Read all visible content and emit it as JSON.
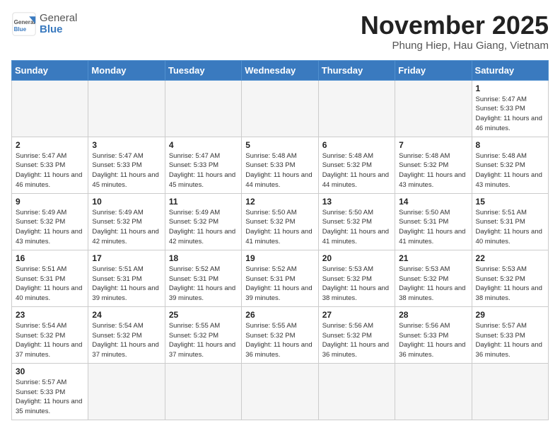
{
  "header": {
    "logo_text_1": "General",
    "logo_text_2": "Blue",
    "month_title": "November 2025",
    "location": "Phung Hiep, Hau Giang, Vietnam"
  },
  "weekdays": [
    "Sunday",
    "Monday",
    "Tuesday",
    "Wednesday",
    "Thursday",
    "Friday",
    "Saturday"
  ],
  "weeks": [
    [
      {
        "day": "",
        "info": ""
      },
      {
        "day": "",
        "info": ""
      },
      {
        "day": "",
        "info": ""
      },
      {
        "day": "",
        "info": ""
      },
      {
        "day": "",
        "info": ""
      },
      {
        "day": "",
        "info": ""
      },
      {
        "day": "1",
        "info": "Sunrise: 5:47 AM\nSunset: 5:33 PM\nDaylight: 11 hours and 46 minutes."
      }
    ],
    [
      {
        "day": "2",
        "info": "Sunrise: 5:47 AM\nSunset: 5:33 PM\nDaylight: 11 hours and 46 minutes."
      },
      {
        "day": "3",
        "info": "Sunrise: 5:47 AM\nSunset: 5:33 PM\nDaylight: 11 hours and 45 minutes."
      },
      {
        "day": "4",
        "info": "Sunrise: 5:47 AM\nSunset: 5:33 PM\nDaylight: 11 hours and 45 minutes."
      },
      {
        "day": "5",
        "info": "Sunrise: 5:48 AM\nSunset: 5:33 PM\nDaylight: 11 hours and 44 minutes."
      },
      {
        "day": "6",
        "info": "Sunrise: 5:48 AM\nSunset: 5:32 PM\nDaylight: 11 hours and 44 minutes."
      },
      {
        "day": "7",
        "info": "Sunrise: 5:48 AM\nSunset: 5:32 PM\nDaylight: 11 hours and 43 minutes."
      },
      {
        "day": "8",
        "info": "Sunrise: 5:48 AM\nSunset: 5:32 PM\nDaylight: 11 hours and 43 minutes."
      }
    ],
    [
      {
        "day": "9",
        "info": "Sunrise: 5:49 AM\nSunset: 5:32 PM\nDaylight: 11 hours and 43 minutes."
      },
      {
        "day": "10",
        "info": "Sunrise: 5:49 AM\nSunset: 5:32 PM\nDaylight: 11 hours and 42 minutes."
      },
      {
        "day": "11",
        "info": "Sunrise: 5:49 AM\nSunset: 5:32 PM\nDaylight: 11 hours and 42 minutes."
      },
      {
        "day": "12",
        "info": "Sunrise: 5:50 AM\nSunset: 5:32 PM\nDaylight: 11 hours and 41 minutes."
      },
      {
        "day": "13",
        "info": "Sunrise: 5:50 AM\nSunset: 5:32 PM\nDaylight: 11 hours and 41 minutes."
      },
      {
        "day": "14",
        "info": "Sunrise: 5:50 AM\nSunset: 5:31 PM\nDaylight: 11 hours and 41 minutes."
      },
      {
        "day": "15",
        "info": "Sunrise: 5:51 AM\nSunset: 5:31 PM\nDaylight: 11 hours and 40 minutes."
      }
    ],
    [
      {
        "day": "16",
        "info": "Sunrise: 5:51 AM\nSunset: 5:31 PM\nDaylight: 11 hours and 40 minutes."
      },
      {
        "day": "17",
        "info": "Sunrise: 5:51 AM\nSunset: 5:31 PM\nDaylight: 11 hours and 39 minutes."
      },
      {
        "day": "18",
        "info": "Sunrise: 5:52 AM\nSunset: 5:31 PM\nDaylight: 11 hours and 39 minutes."
      },
      {
        "day": "19",
        "info": "Sunrise: 5:52 AM\nSunset: 5:31 PM\nDaylight: 11 hours and 39 minutes."
      },
      {
        "day": "20",
        "info": "Sunrise: 5:53 AM\nSunset: 5:32 PM\nDaylight: 11 hours and 38 minutes."
      },
      {
        "day": "21",
        "info": "Sunrise: 5:53 AM\nSunset: 5:32 PM\nDaylight: 11 hours and 38 minutes."
      },
      {
        "day": "22",
        "info": "Sunrise: 5:53 AM\nSunset: 5:32 PM\nDaylight: 11 hours and 38 minutes."
      }
    ],
    [
      {
        "day": "23",
        "info": "Sunrise: 5:54 AM\nSunset: 5:32 PM\nDaylight: 11 hours and 37 minutes."
      },
      {
        "day": "24",
        "info": "Sunrise: 5:54 AM\nSunset: 5:32 PM\nDaylight: 11 hours and 37 minutes."
      },
      {
        "day": "25",
        "info": "Sunrise: 5:55 AM\nSunset: 5:32 PM\nDaylight: 11 hours and 37 minutes."
      },
      {
        "day": "26",
        "info": "Sunrise: 5:55 AM\nSunset: 5:32 PM\nDaylight: 11 hours and 36 minutes."
      },
      {
        "day": "27",
        "info": "Sunrise: 5:56 AM\nSunset: 5:32 PM\nDaylight: 11 hours and 36 minutes."
      },
      {
        "day": "28",
        "info": "Sunrise: 5:56 AM\nSunset: 5:33 PM\nDaylight: 11 hours and 36 minutes."
      },
      {
        "day": "29",
        "info": "Sunrise: 5:57 AM\nSunset: 5:33 PM\nDaylight: 11 hours and 36 minutes."
      }
    ],
    [
      {
        "day": "30",
        "info": "Sunrise: 5:57 AM\nSunset: 5:33 PM\nDaylight: 11 hours and 35 minutes."
      },
      {
        "day": "",
        "info": ""
      },
      {
        "day": "",
        "info": ""
      },
      {
        "day": "",
        "info": ""
      },
      {
        "day": "",
        "info": ""
      },
      {
        "day": "",
        "info": ""
      },
      {
        "day": "",
        "info": ""
      }
    ]
  ]
}
